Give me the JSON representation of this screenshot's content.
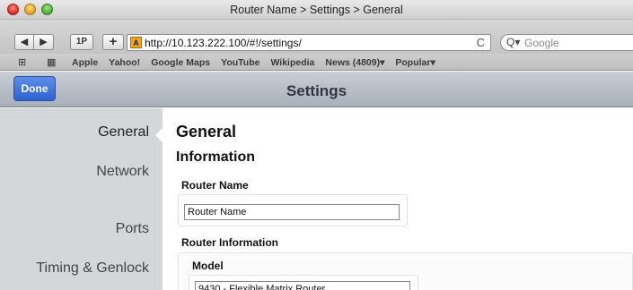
{
  "window": {
    "title": "Router Name > Settings > General"
  },
  "toolbar": {
    "back_label": "◀",
    "forward_label": "▶",
    "onepassword_label": "1P",
    "add_label": "+",
    "favicon_label": "A",
    "url": "http://10.123.222.100/#!/settings/",
    "reload_label": "C",
    "search_icon": "Q▾",
    "search_placeholder": "Google"
  },
  "bookmarks": {
    "book_icon": "⊞",
    "grid_icon": "▦",
    "items": [
      "Apple",
      "Yahoo!",
      "Google Maps",
      "YouTube",
      "Wikipedia",
      "News (4809)▾",
      "Popular▾"
    ]
  },
  "app_header": {
    "done_label": "Done",
    "title": "Settings"
  },
  "sidebar": {
    "items": [
      "General",
      "Network",
      "Ports",
      "Timing & Genlock"
    ],
    "selected": "General"
  },
  "main": {
    "heading": "General",
    "section_heading": "Information",
    "router_name_label": "Router Name",
    "router_name_value": "Router Name",
    "router_info_label": "Router Information",
    "model_label": "Model",
    "model_value": "9430 - Flexible Matrix Router"
  },
  "colors": {
    "accent_button": "#2d63d0",
    "sidebar_bg": "#d4d6d9",
    "header_bg": "#a8afb8"
  }
}
